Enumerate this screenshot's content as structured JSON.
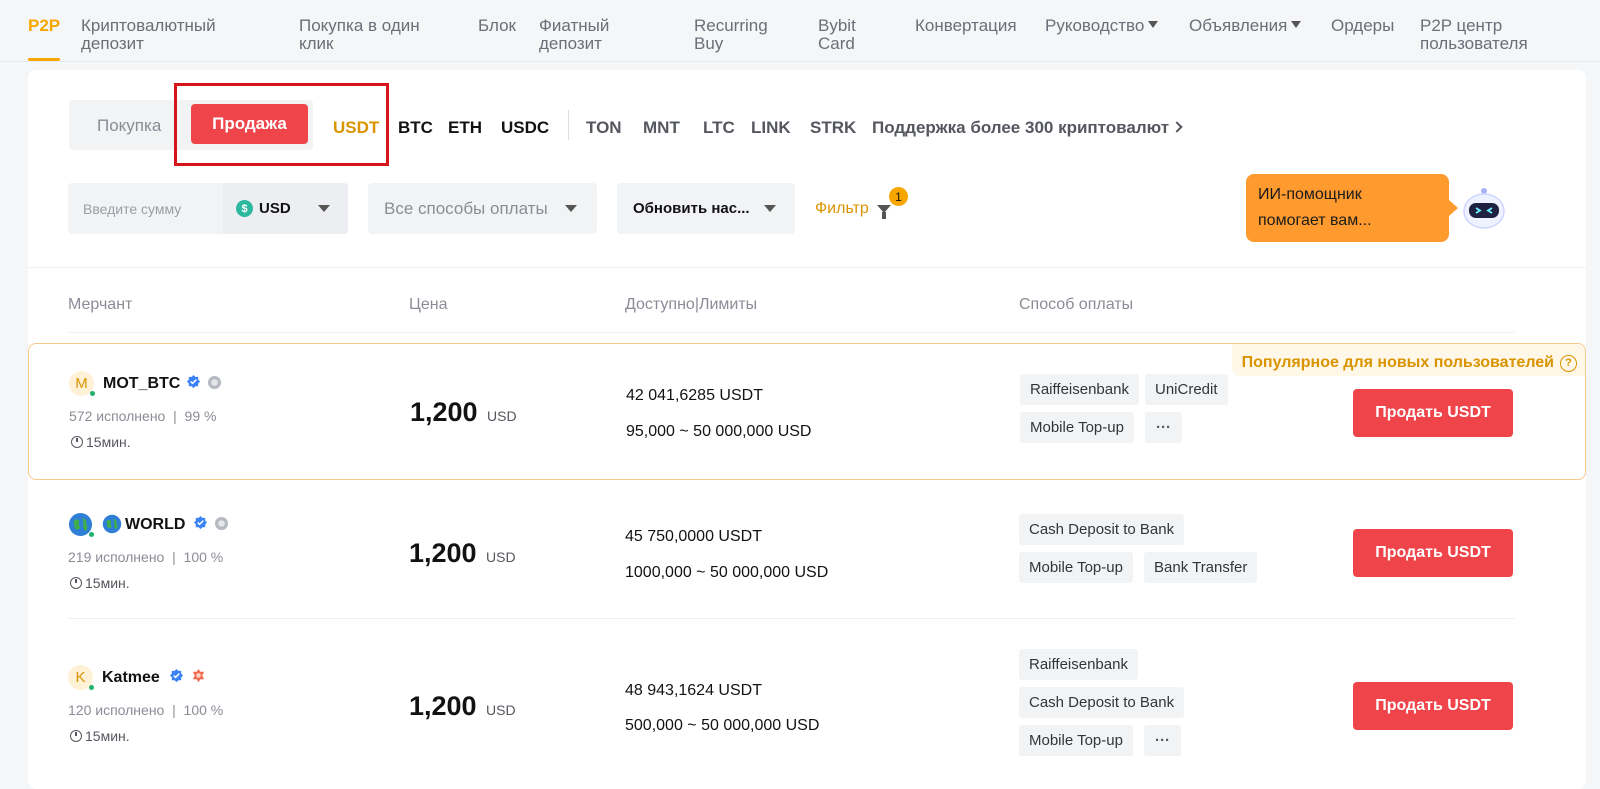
{
  "nav": {
    "items": [
      "P2P",
      "Криптовалютный\nдепозит",
      "Покупка в один\nклик",
      "Блок",
      "Фиатный\nдепозит",
      "Recurring\nBuy",
      "Bybit\nCard",
      "Конвертация",
      "Руководство",
      "Объявления",
      "Ордеры",
      "P2P центр\nпользователя"
    ]
  },
  "trade": {
    "buy_label": "Покупка",
    "sell_label": "Продажа"
  },
  "coins": [
    "USDT",
    "BTC",
    "ETH",
    "USDC",
    "TON",
    "MNT",
    "LTC",
    "LINK",
    "STRK"
  ],
  "support_link": "Поддержка более 300 криптовалют",
  "filters": {
    "amount_placeholder": "Введите сумму",
    "currency": "USD",
    "currency_symbol": "$",
    "payment_method": "Все способы оплаты",
    "refresh": "Обновить нас...",
    "filter_label": "Фильтр",
    "filter_count": "1"
  },
  "ai": {
    "line1": "ИИ-помощник",
    "line2": "помогает вам..."
  },
  "table": {
    "headers": {
      "merchant": "Мерчант",
      "price": "Цена",
      "available": "Доступно|Лимиты",
      "payment": "Способ оплаты"
    },
    "popular_tag": "Популярное для новых пользователей",
    "rows": [
      {
        "avatar": "M",
        "name": "MOT_BTC",
        "stats": "572 исполнено  |  99 %",
        "time": "15мин.",
        "price": "1,200",
        "currency": "USD",
        "available": "42 041,6285 USDT",
        "limits": "95,000 ~ 50 000,000 USD",
        "payments": [
          "Raiffeisenbank",
          "UniCredit",
          "Mobile Top-up",
          "···"
        ],
        "button": "Продать USDT"
      },
      {
        "avatar": "",
        "name": "WORLD",
        "stats": "219 исполнено  |  100 %",
        "time": "15мин.",
        "price": "1,200",
        "currency": "USD",
        "available": "45 750,0000 USDT",
        "limits": "1000,000 ~ 50 000,000 USD",
        "payments": [
          "Cash Deposit to Bank",
          "Mobile Top-up",
          "Bank Transfer"
        ],
        "button": "Продать USDT"
      },
      {
        "avatar": "K",
        "name": "Katmee",
        "stats": "120 исполнено  |  100 %",
        "time": "15мин.",
        "price": "1,200",
        "currency": "USD",
        "available": "48 943,1624 USDT",
        "limits": "500,000 ~ 50 000,000 USD",
        "payments": [
          "Raiffeisenbank",
          "Cash Deposit to Bank",
          "Mobile Top-up",
          "···"
        ],
        "button": "Продать USDT"
      }
    ]
  },
  "colors": {
    "accent": "#f7a600",
    "sell": "#ef454a",
    "highlight": "#d7141a"
  }
}
